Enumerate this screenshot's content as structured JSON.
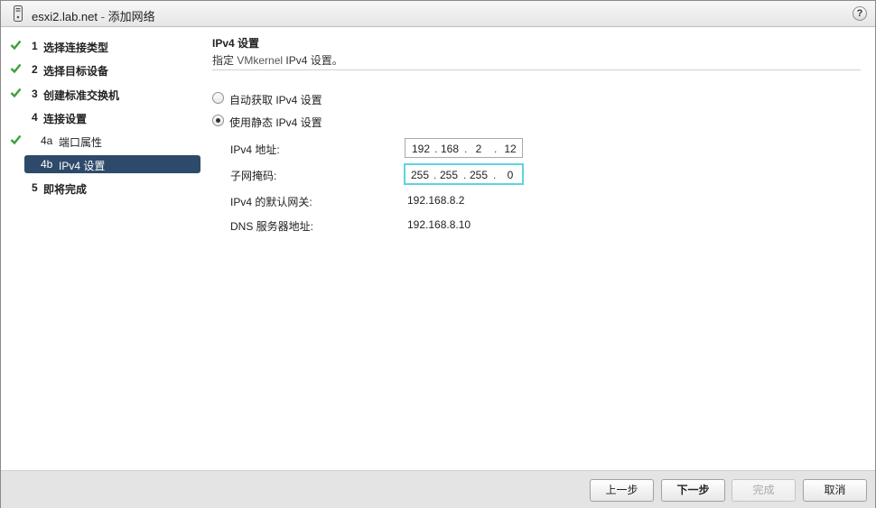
{
  "titlebar": {
    "host": "esxi2.lab.net",
    "separator": " - ",
    "title": "添加网络",
    "icon": "server-icon",
    "help": "?"
  },
  "sidebar": {
    "items": [
      {
        "num": "1",
        "label": "选择连接类型",
        "completed": true
      },
      {
        "num": "2",
        "label": "选择目标设备",
        "completed": true
      },
      {
        "num": "3",
        "label": "创建标准交换机",
        "completed": true
      },
      {
        "num": "4",
        "label": "连接设置",
        "completed": false
      },
      {
        "num": "4a",
        "label": "端口属性",
        "completed": true
      },
      {
        "num": "4b",
        "label": "IPv4 设置",
        "completed": false,
        "active": true
      },
      {
        "num": "5",
        "label": "即将完成",
        "completed": false
      }
    ]
  },
  "main": {
    "section_title": "IPv4 设置",
    "section_subtitle_prefix": "指定 ",
    "section_subtitle_link": "VMkernel",
    "section_subtitle_suffix": " IPv4 设置。",
    "radio_auto": "自动获取 IPv4 设置",
    "radio_static": "使用静态 IPv4 设置",
    "selected_mode": "static",
    "ipv4_label": "IPv4 地址:",
    "ipv4_octets": [
      "192",
      "168",
      "2",
      "12"
    ],
    "subnet_label": "子网掩码:",
    "subnet_octets": [
      "255",
      "255",
      "255",
      "0"
    ],
    "gateway_label": "IPv4 的默认网关:",
    "gateway_value": "192.168.8.2",
    "dns_label": "DNS 服务器地址:",
    "dns_value": "192.168.8.10"
  },
  "footer": {
    "back": "上一步",
    "next": "下一步",
    "finish": "完成",
    "cancel": "取消"
  },
  "colors": {
    "check": "#3aa03a",
    "active_nav": "#2e4a6a",
    "focus_ring": "#5fd3e0",
    "link": "#555555"
  }
}
